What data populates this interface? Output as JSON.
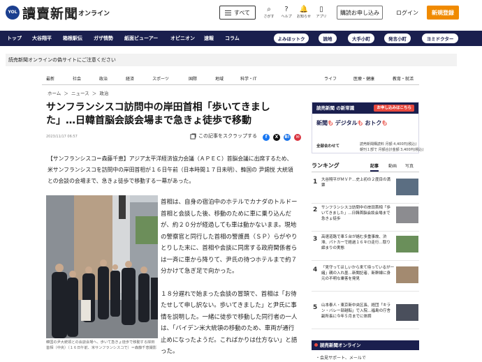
{
  "header": {
    "logo_mark": "YOL",
    "logo_main": "讀賣新聞",
    "logo_sub": "オンライン",
    "all_label": "すべて",
    "icons": [
      {
        "name": "search-icon",
        "glyph": "⌕",
        "label": "さがす"
      },
      {
        "name": "help-icon",
        "glyph": "?",
        "label": "ヘルプ"
      },
      {
        "name": "bell-icon",
        "glyph": "🔔",
        "label": "お知らせ"
      },
      {
        "name": "app-icon",
        "glyph": "▯",
        "label": "アプリ"
      }
    ],
    "subscribe_label": "購読お申し込み",
    "login_label": "ログイン",
    "register_label": "新規登録"
  },
  "nav": {
    "items": [
      "トップ",
      "大谷翔平",
      "箱根駅伝",
      "ガザ情勢",
      "紙面ビューアー",
      "オピニオン",
      "速報",
      "コラム"
    ],
    "pills": [
      "よみほットク",
      "読地",
      "大手小町",
      "発言小町",
      "ヨミドクター"
    ]
  },
  "notice": "読売新聞オンラインの偽サイトにご注意ください",
  "categories": [
    "最新",
    "社会",
    "政治",
    "経済",
    "スポーツ",
    "国際",
    "地域",
    "科学・IT",
    "ライフ",
    "医療・健康",
    "教育・就活"
  ],
  "breadcrumb": [
    "ホーム",
    "＞",
    "ニュース",
    "＞",
    "政治"
  ],
  "article": {
    "headline": "サンフランシスコ訪問中の岸田首相「歩いてきました」…日韓首脳会談会場まで急きょ徒歩で移動",
    "date": "2023/11/17 06:57",
    "scrap_label": "この記事をスクラップする",
    "lead": "【サンフランシスコ＝森藤千恵】アジア太平洋経済協力会議（ＡＰＥＣ）首脳会議に出席するため、米サンフランシスコを訪問中の岸田首相が１６日午前（日本時間１７日未明）、韓国の 尹錫悦 大統領との会談の会場まで、急きょ徒歩で移動する一幕があった。",
    "caption": "韓国の尹大統領との会談会場へ、歩いて急きょ徒歩で移動する岸田首相（中央）（１６日午前、米サンフランシスコで）＝森藤千恵撮影",
    "paragraphs": [
      "首相は、自身の宿泊中のホテルでカナダのトルドー首相と会談した後、移動のために車に乗り込んだが、約２０分が経過しても車は動かないまま。現地の警察官と同行した首相の警護員（ＳＰ）らがやりとりした末に、首相や会談に同席する政府関係者らは一斉に車から降りて、尹氏の待つホテルまで約７分かけて急ぎ足で向かった。",
      "１８分遅れで始まった会談の冒頭で、首相は「お待たせして申し訳ない。歩いてきました」と尹氏に事情を説明した。一緒に徒歩で移動した同行者の一人は、「バイデン米大統領の移動のため、車両が通行止めになったようだ。こればかりは仕方ない」と語った。"
    ]
  },
  "sidebar": {
    "promo": {
      "head": "読売新聞 の新常識",
      "tag": "お申し込みはこちら",
      "words": [
        "新聞",
        "も",
        "デジタル",
        "も",
        "おトク",
        "も"
      ],
      "bottom": "全部合わせて",
      "price_line1": "読売新聞購読料 月額 4,400円(税込)",
      "price_line2": "朝刊１部で 月額合計金額 3,400円(税込)"
    },
    "ranking": {
      "title": "ランキング",
      "tabs": [
        "記事",
        "動画",
        "写真"
      ],
      "items": [
        {
          "num": "1",
          "text": "大谷翔平がＭＶＰ…史上初の２度目の満票",
          "thumb_color": "#5b6e82"
        },
        {
          "num": "2",
          "text": "サンフランシスコ訪問中の岸田首相「歩いてきました」…日韓首脳会談会場まで急きょ徒歩",
          "thumb_color": "#8c8c90"
        },
        {
          "num": "3",
          "text": "高速道路で車５台が絡む多重事故、渋滞、パトカーで経過１６キロ走行…取り締まりの実態",
          "thumb_color": "#6a8f5a"
        },
        {
          "num": "4",
          "text": "「見守ってほしいから来て待っているが一緒」親の入れ墨…新聞記者、新幹線に身元の不明な乗客を発見",
          "thumb_color": "#a38a70"
        },
        {
          "num": "5",
          "text": "山本泰人・東京新中央区長、経団「キラン・バレー部越転」で入院…福島の庁舎副所長に今年５月までに体調",
          "thumb_color": "#4a4f5c"
        }
      ]
    },
    "special": {
      "title": "読売新聞オンライン",
      "item": "・会見サポート、メールで"
    }
  }
}
